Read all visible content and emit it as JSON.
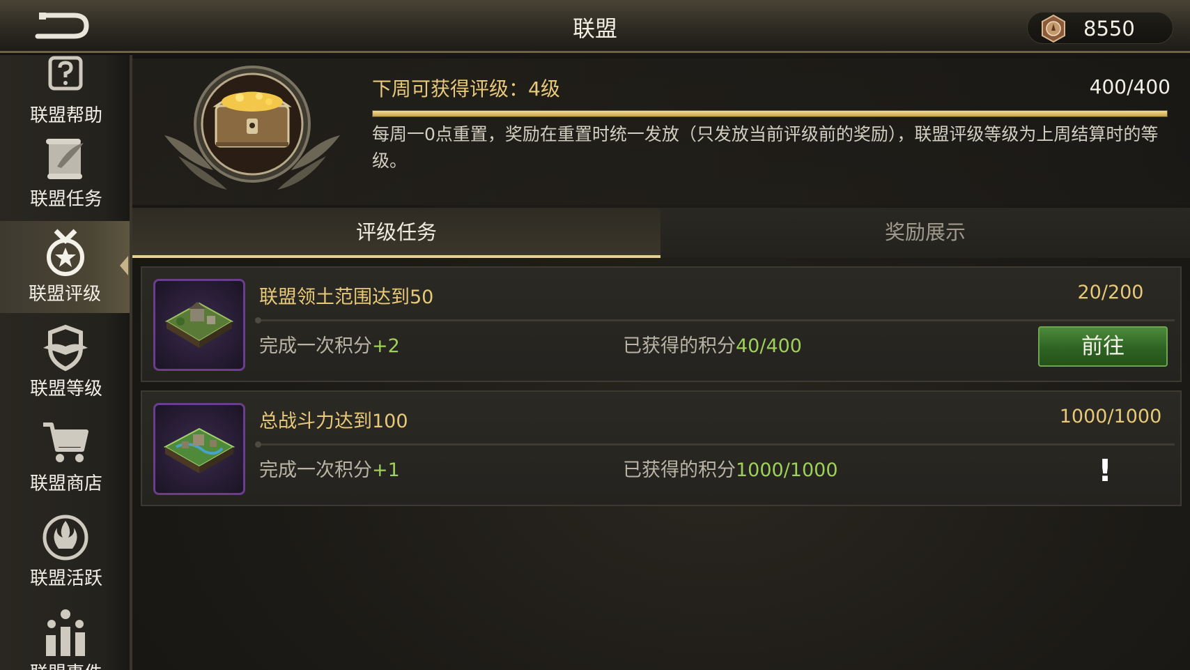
{
  "header": {
    "title": "联盟",
    "currency": {
      "value": "8550",
      "icon": "medal-icon"
    }
  },
  "sidebar": {
    "items": [
      {
        "label": "联盟帮助",
        "icon": "help-icon"
      },
      {
        "label": "联盟任务",
        "icon": "scroll-quill-icon"
      },
      {
        "label": "联盟评级",
        "icon": "star-medal-icon",
        "active": true
      },
      {
        "label": "联盟等级",
        "icon": "winged-shield-icon"
      },
      {
        "label": "联盟商店",
        "icon": "cart-icon"
      },
      {
        "label": "联盟活跃",
        "icon": "flame-wings-icon"
      },
      {
        "label": "联盟事件",
        "icon": "people-chart-icon"
      }
    ]
  },
  "rating": {
    "label": "下周可获得评级：",
    "value": "4级",
    "score": "400/400",
    "progress_fraction": 1.0,
    "description": "每周一0点重置，奖励在重置时统一发放（只发放当前评级前的奖励），联盟评级等级为上周结算时的等级。"
  },
  "tabs": [
    {
      "label": "评级任务",
      "active": true
    },
    {
      "label": "奖励展示",
      "active": false
    }
  ],
  "tasks": [
    {
      "title": "联盟领土范围达到50",
      "progress": "20/200",
      "per_label": "完成一次积分",
      "per_value": "+2",
      "earned_label": "已获得的积分",
      "earned_value": "40/400",
      "action_label": "前往",
      "thumb_icon": "territory-icon"
    },
    {
      "title": "总战斗力达到100",
      "progress": "1000/1000",
      "per_label": "完成一次积分",
      "per_value": "+1",
      "earned_label": "已获得的积分",
      "earned_value": "1000/1000",
      "status_mark": "!",
      "thumb_icon": "fortress-icon"
    }
  ],
  "colors": {
    "accent_gold": "#e8c97a",
    "score_green": "#9fd15a",
    "button_green": "#2e6324",
    "thumb_border_purple": "#6a3d8e"
  }
}
